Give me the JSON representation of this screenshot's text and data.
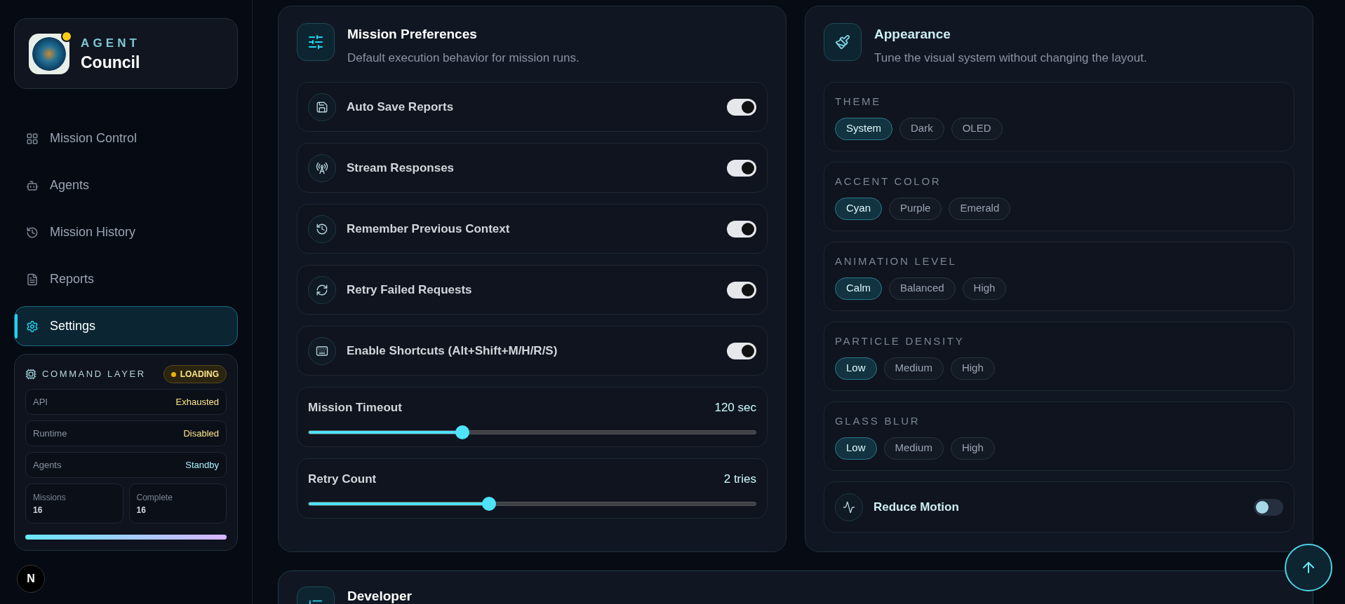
{
  "brand": {
    "overline": "AGENT",
    "name": "Council",
    "notification": true
  },
  "nav": [
    {
      "label": "Mission Control",
      "selected": false
    },
    {
      "label": "Agents",
      "selected": false
    },
    {
      "label": "Mission History",
      "selected": false
    },
    {
      "label": "Reports",
      "selected": false
    },
    {
      "label": "Settings",
      "selected": true
    }
  ],
  "command_layer": {
    "title": "COMMAND LAYER",
    "badge": {
      "label": "LOADING",
      "color": "#eab308"
    },
    "rows": [
      {
        "label": "API",
        "value": "Exhausted",
        "color": "#fde68a"
      },
      {
        "label": "Runtime",
        "value": "Disabled",
        "color": "#fde68a"
      },
      {
        "label": "Agents",
        "value": "Standby",
        "color": "#a5f3fc"
      }
    ],
    "stats": [
      {
        "label": "Missions",
        "value": "16"
      },
      {
        "label": "Complete",
        "value": "16"
      }
    ],
    "progress": {
      "level": 1
    }
  },
  "dev_badge": "N",
  "mission_preferences": {
    "title": "Mission Preferences",
    "subtitle": "Default execution behavior for mission runs.",
    "toggles": [
      {
        "label": "Auto Save Reports",
        "on": true
      },
      {
        "label": "Stream Responses",
        "on": true
      },
      {
        "label": "Remember Previous Context",
        "on": true
      },
      {
        "label": "Retry Failed Requests",
        "on": true
      },
      {
        "label": "Enable Shortcuts (Alt+Shift+M/H/R/S)",
        "on": true
      }
    ],
    "sliders": [
      {
        "label": "Mission Timeout",
        "reading": "120 sec",
        "level": 0.34
      },
      {
        "label": "Retry Count",
        "reading": "2 tries",
        "level": 0.4
      }
    ]
  },
  "appearance": {
    "title": "Appearance",
    "subtitle": "Tune the visual system without changing the layout.",
    "groups": [
      {
        "label": "THEME",
        "options": [
          {
            "label": "System",
            "selected": true
          },
          {
            "label": "Dark",
            "selected": false
          },
          {
            "label": "OLED",
            "selected": false
          }
        ]
      },
      {
        "label": "ACCENT COLOR",
        "options": [
          {
            "label": "Cyan",
            "selected": true
          },
          {
            "label": "Purple",
            "selected": false
          },
          {
            "label": "Emerald",
            "selected": false
          }
        ]
      },
      {
        "label": "ANIMATION LEVEL",
        "options": [
          {
            "label": "Calm",
            "selected": true
          },
          {
            "label": "Balanced",
            "selected": false
          },
          {
            "label": "High",
            "selected": false
          }
        ]
      },
      {
        "label": "PARTICLE DENSITY",
        "options": [
          {
            "label": "Low",
            "selected": true
          },
          {
            "label": "Medium",
            "selected": false
          },
          {
            "label": "High",
            "selected": false
          }
        ]
      },
      {
        "label": "GLASS BLUR",
        "options": [
          {
            "label": "Low",
            "selected": true
          },
          {
            "label": "Medium",
            "selected": false
          },
          {
            "label": "High",
            "selected": false
          }
        ]
      }
    ],
    "reduce_motion": {
      "label": "Reduce Motion",
      "on": false
    }
  },
  "developer": {
    "title": "Developer"
  }
}
